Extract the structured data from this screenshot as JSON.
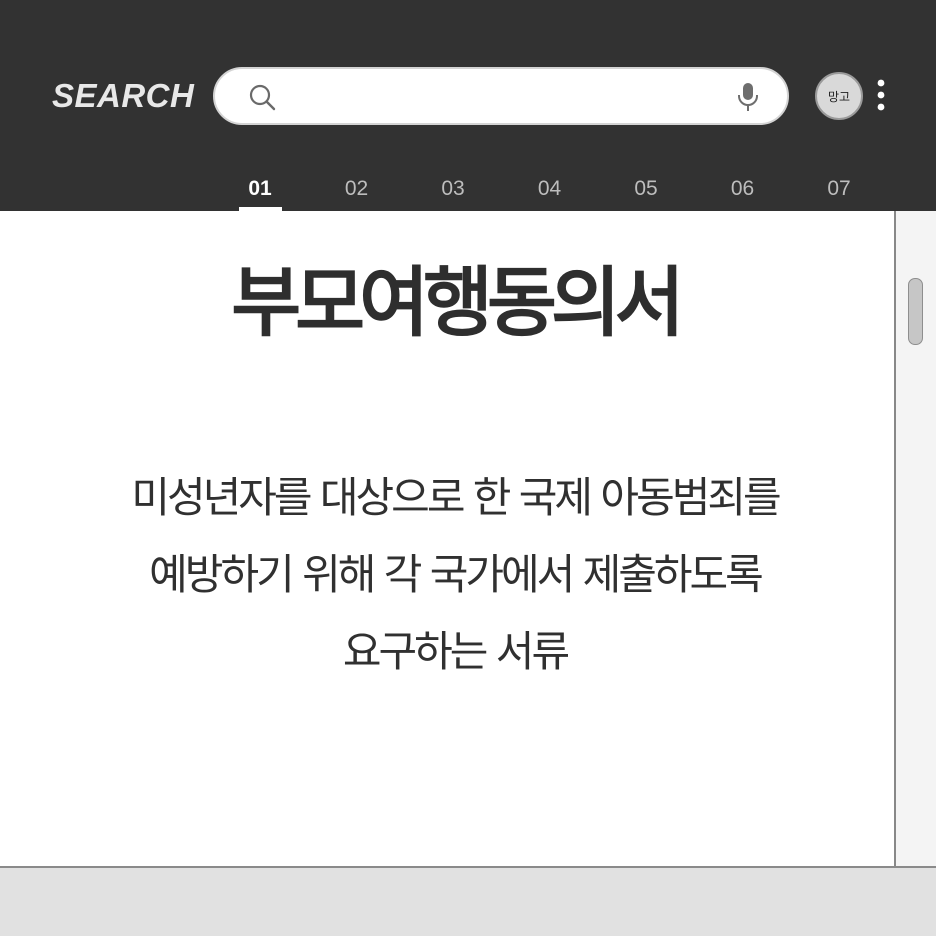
{
  "header": {
    "brand": "SEARCH",
    "search": {
      "value": "",
      "placeholder": ""
    },
    "avatar_label": "망고",
    "tabs": [
      {
        "label": "01",
        "active": true
      },
      {
        "label": "02",
        "active": false
      },
      {
        "label": "03",
        "active": false
      },
      {
        "label": "04",
        "active": false
      },
      {
        "label": "05",
        "active": false
      },
      {
        "label": "06",
        "active": false
      },
      {
        "label": "07",
        "active": false
      }
    ]
  },
  "main": {
    "title": "부모여행동의서",
    "description_lines": [
      "미성년자를 대상으로 한 국제 아동범죄를",
      "예방하기 위해 각 국가에서 제출하도록",
      "요구하는 서류"
    ]
  },
  "icons": {
    "search": "search-icon",
    "mic": "microphone-icon",
    "more": "more-vertical-icon"
  },
  "colors": {
    "header_bg": "#323232",
    "content_bg": "#ffffff",
    "text": "#2e2e2e",
    "tab_active": "#ffffff",
    "tab_inactive": "#bdbdbd"
  }
}
